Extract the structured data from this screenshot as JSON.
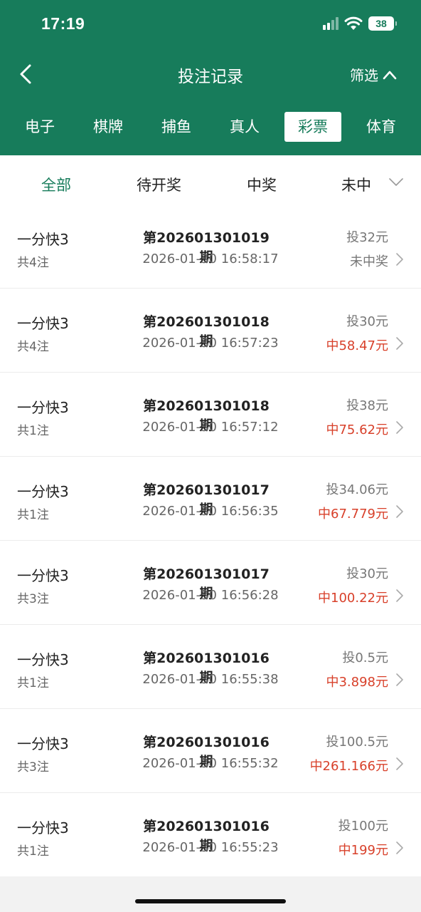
{
  "status_bar": {
    "time": "17:19",
    "battery": "38"
  },
  "header": {
    "title": "投注记录",
    "filter_label": "筛选"
  },
  "category_tabs": [
    {
      "label": "电子"
    },
    {
      "label": "棋牌"
    },
    {
      "label": "捕鱼"
    },
    {
      "label": "真人"
    },
    {
      "label": "彩票",
      "selected": true
    },
    {
      "label": "体育"
    }
  ],
  "status_tabs": [
    {
      "label": "全部",
      "selected": true
    },
    {
      "label": "待开奖"
    },
    {
      "label": "中奖"
    },
    {
      "label": "未中"
    }
  ],
  "records": [
    {
      "name": "一分快3",
      "count": "共4注",
      "issue": "第202601301019期",
      "time": "2026-01-30 16:58:17",
      "stake": "投32元",
      "result": "未中奖",
      "win": false
    },
    {
      "name": "一分快3",
      "count": "共4注",
      "issue": "第202601301018期",
      "time": "2026-01-30 16:57:23",
      "stake": "投30元",
      "result": "中58.47元",
      "win": true
    },
    {
      "name": "一分快3",
      "count": "共1注",
      "issue": "第202601301018期",
      "time": "2026-01-30 16:57:12",
      "stake": "投38元",
      "result": "中75.62元",
      "win": true
    },
    {
      "name": "一分快3",
      "count": "共1注",
      "issue": "第202601301017期",
      "time": "2026-01-30 16:56:35",
      "stake": "投34.06元",
      "result": "中67.779元",
      "win": true
    },
    {
      "name": "一分快3",
      "count": "共3注",
      "issue": "第202601301017期",
      "time": "2026-01-30 16:56:28",
      "stake": "投30元",
      "result": "中100.22元",
      "win": true
    },
    {
      "name": "一分快3",
      "count": "共1注",
      "issue": "第202601301016期",
      "time": "2026-01-30 16:55:38",
      "stake": "投0.5元",
      "result": "中3.898元",
      "win": true
    },
    {
      "name": "一分快3",
      "count": "共3注",
      "issue": "第202601301016期",
      "time": "2026-01-30 16:55:32",
      "stake": "投100.5元",
      "result": "中261.166元",
      "win": true
    },
    {
      "name": "一分快3",
      "count": "共1注",
      "issue": "第202601301016期",
      "time": "2026-01-30 16:55:23",
      "stake": "投100元",
      "result": "中199元",
      "win": true
    }
  ],
  "colors": {
    "brand_green": "#177c5b",
    "win_red": "#d8402a",
    "background": "#f2f2f2"
  }
}
